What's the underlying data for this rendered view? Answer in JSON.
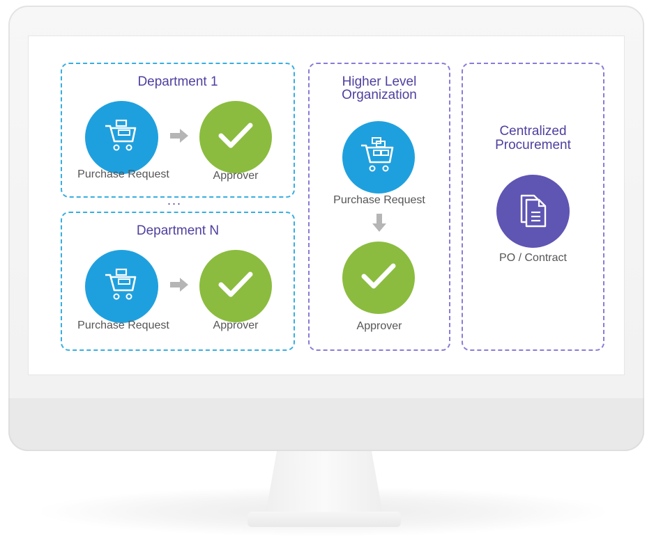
{
  "diagram": {
    "dept1": {
      "title": "Department 1",
      "request_label": "Purchase Request",
      "approver_label": "Approver"
    },
    "ellipsis": "...",
    "deptN": {
      "title": "Department N",
      "request_label": "Purchase Request",
      "approver_label": "Approver"
    },
    "higher": {
      "title_line1": "Higher Level",
      "title_line2": "Organization",
      "request_label": "Purchase Request",
      "approver_label": "Approver"
    },
    "central": {
      "title_line1": "Centralized",
      "title_line2": "Procurement",
      "doc_label": "PO / Contract"
    }
  },
  "colors": {
    "blue_accent": "#1fa0de",
    "green_accent": "#8bbc3f",
    "purple_accent": "#5f55b3",
    "title_text": "#4f3f9f",
    "dashed_blue": "#35aee0",
    "dashed_purple": "#8a7bd6"
  },
  "icons": {
    "cart": "cart-icon",
    "check": "checkmark-icon",
    "document": "document-icon",
    "arrow_right": "arrow-right-icon",
    "arrow_down": "arrow-down-icon"
  }
}
